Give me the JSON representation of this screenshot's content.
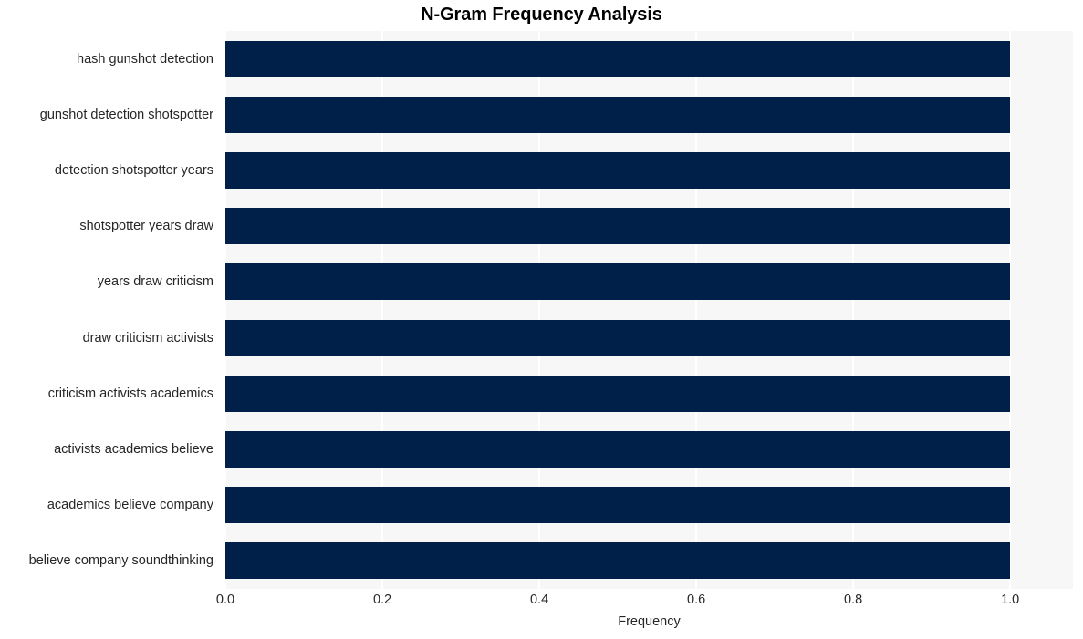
{
  "chart_data": {
    "type": "bar",
    "orientation": "horizontal",
    "title": "N-Gram Frequency Analysis",
    "xlabel": "Frequency",
    "ylabel": "",
    "categories": [
      "hash gunshot detection",
      "gunshot detection shotspotter",
      "detection shotspotter years",
      "shotspotter years draw",
      "years draw criticism",
      "draw criticism activists",
      "criticism activists academics",
      "activists academics believe",
      "academics believe company",
      "believe company soundthinking"
    ],
    "values": [
      1.0,
      1.0,
      1.0,
      1.0,
      1.0,
      1.0,
      1.0,
      1.0,
      1.0,
      1.0
    ],
    "xlim": [
      0.0,
      1.08
    ],
    "xticks": [
      "0.0",
      "0.2",
      "0.4",
      "0.6",
      "0.8",
      "1.0"
    ],
    "xtick_values": [
      0.0,
      0.2,
      0.4,
      0.6,
      0.8,
      1.0
    ],
    "grid": "vertical",
    "legend": null,
    "bar_color": "#012049",
    "plot_background": "#f7f7f7",
    "gridline_color": "#ffffff",
    "figure_background": "#ffffff",
    "text_color": "#262626",
    "title_color": "#000000"
  }
}
